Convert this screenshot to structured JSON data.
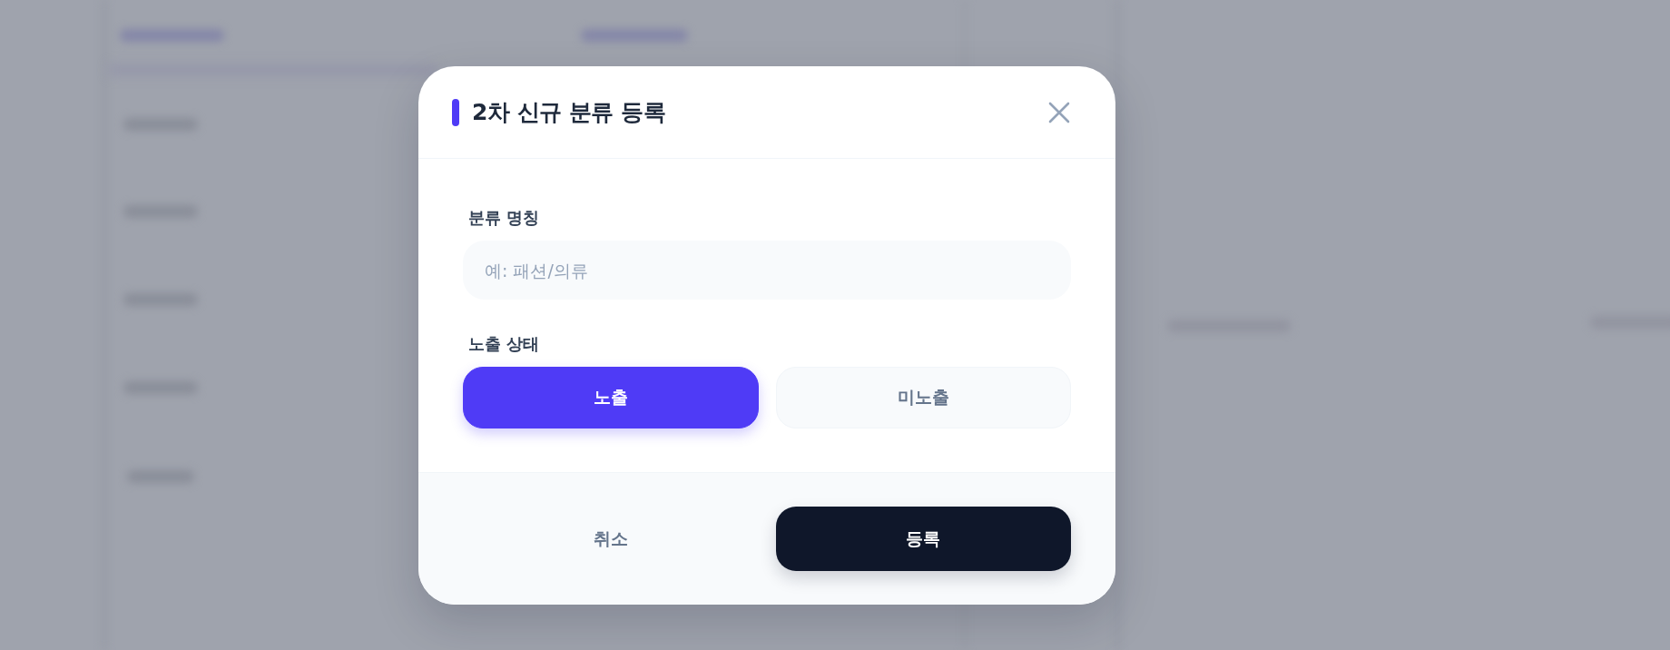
{
  "dialog": {
    "title": "2차 신규 분류 등록",
    "fields": [
      {
        "kind": "text",
        "label": "분류 명칭",
        "placeholder": "예: 패션/의류"
      },
      {
        "kind": "toggle",
        "label": "노출 상태",
        "options": [
          {
            "label": "노출",
            "selected": true
          },
          {
            "label": "미노출",
            "selected": false
          }
        ]
      }
    ],
    "buttons": [
      {
        "kind": "secondary",
        "label": "취소"
      },
      {
        "kind": "primary",
        "label": "등록"
      }
    ]
  }
}
